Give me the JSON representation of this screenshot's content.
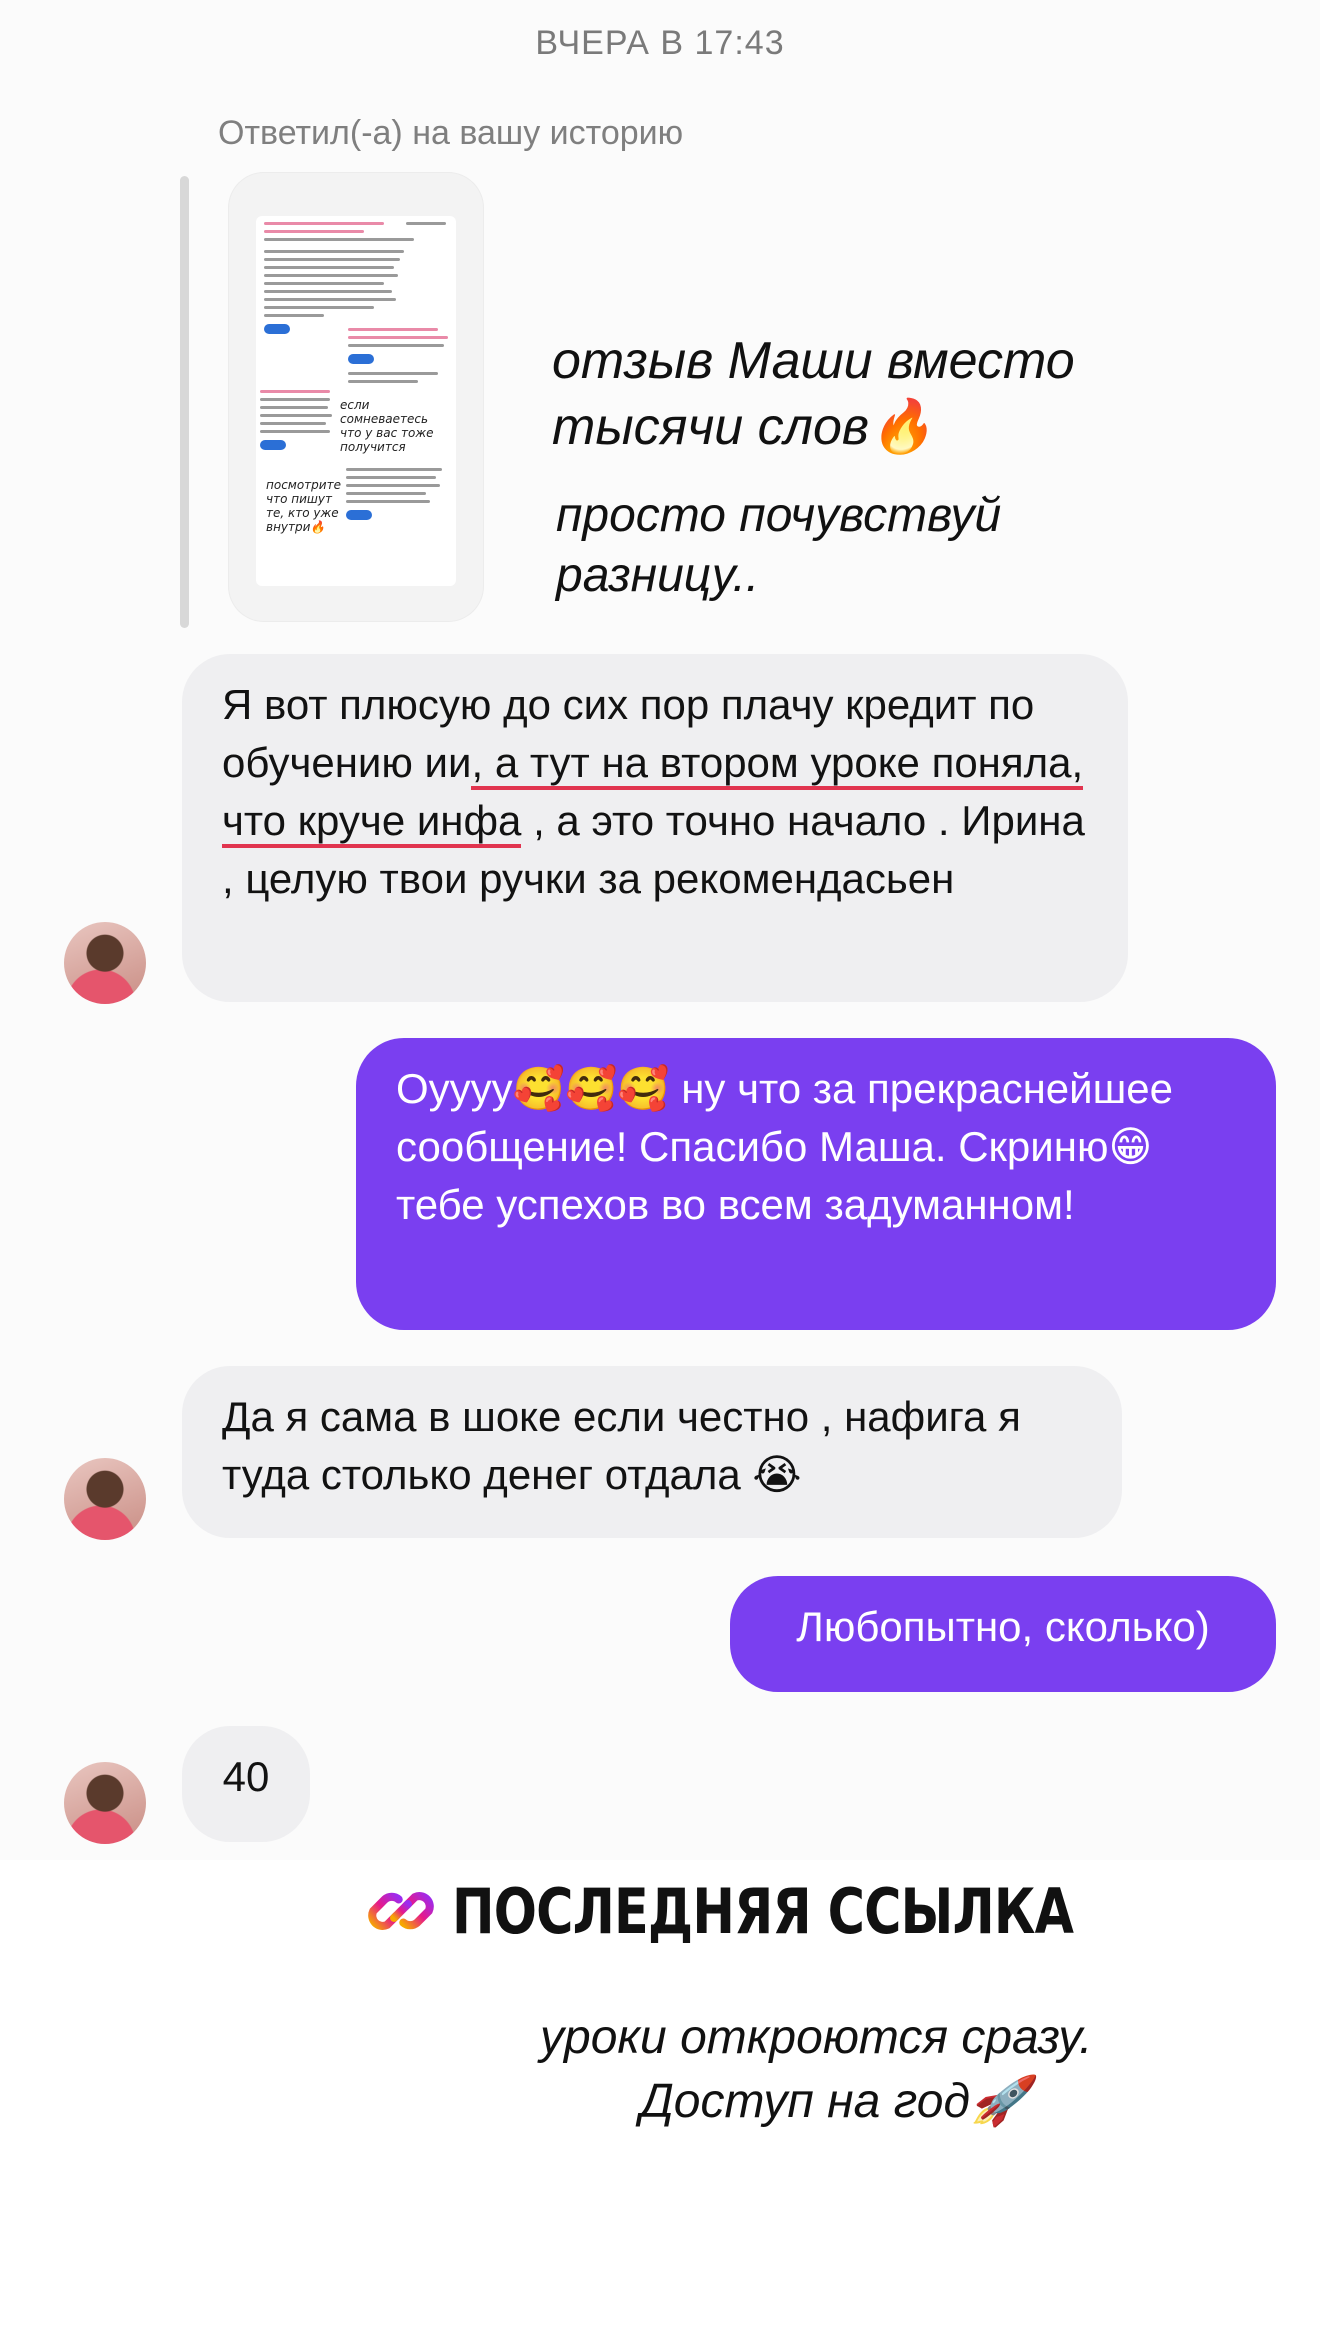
{
  "header": {
    "timestamp": "ВЧЕРА В 17:43"
  },
  "story_reply": {
    "label": "Ответил(-а) на вашу историю",
    "thumbnail_notes": [
      "если сомневаетесь что у вас тоже получится",
      "посмотрите что пишут те, кто уже внутри🔥"
    ],
    "caption_line1": "отзыв Маши вместо",
    "caption_line2": "тысячи слов🔥",
    "caption_line3": "просто почувствуй",
    "caption_line4": "разницу.."
  },
  "messages": [
    {
      "side": "incoming",
      "parts": [
        "Я вот плюсую до сих пор плачу кредит по обучению ии",
        ", а тут на втором уроке поняла, что круче инфа",
        " , а это точно начало . Ирина , целую твои ручки за рекомендасьен"
      ]
    },
    {
      "side": "outgoing",
      "text": "Оуууу🥰🥰🥰 ну что за прекраснейшее сообщение! Спасибо Маша. Скриню😁 тебе успехов во всем задуманном!"
    },
    {
      "side": "incoming",
      "text": "Да я сама в шоке если честно , нафига я туда столько денег отдала 😭"
    },
    {
      "side": "outgoing",
      "text": "Любопытно, сколько)"
    },
    {
      "side": "incoming",
      "text": "40"
    }
  ],
  "footer": {
    "link_icon": "link-icon",
    "link_title": "ПОСЛЕДНЯЯ ССЫЛКА",
    "line1": "уроки откроются сразу.",
    "line2": "Доступ на год🚀"
  },
  "colors": {
    "outgoing_bubble": "#7a3ff0",
    "incoming_bubble": "#efeff1",
    "underline": "#e1344f"
  }
}
